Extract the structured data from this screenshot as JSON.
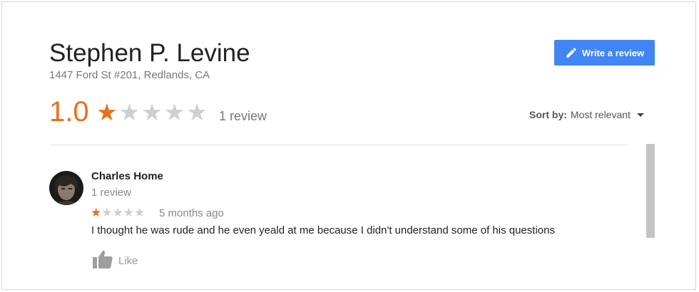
{
  "place": {
    "name": "Stephen P. Levine",
    "address": "1447 Ford St #201, Redlands, CA"
  },
  "write_review": {
    "label": "Write a review",
    "icon": "pencil-icon"
  },
  "summary": {
    "rating_text": "1.0",
    "rating_value": 1,
    "rating_max": 5,
    "review_count": "1 review"
  },
  "sort": {
    "label": "Sort by:",
    "value": "Most relevant"
  },
  "review": {
    "author": "Charles Home",
    "author_review_count": "1 review",
    "stars": 1,
    "stars_max": 5,
    "time": "5 months ago",
    "text": "I thought he was rude and he even yeald at me because I didn't understand some of his questions",
    "like_label": "Like"
  },
  "colors": {
    "accent_orange": "#e7711b",
    "button_blue": "#4285f4",
    "star_off": "#cfcfcf"
  }
}
